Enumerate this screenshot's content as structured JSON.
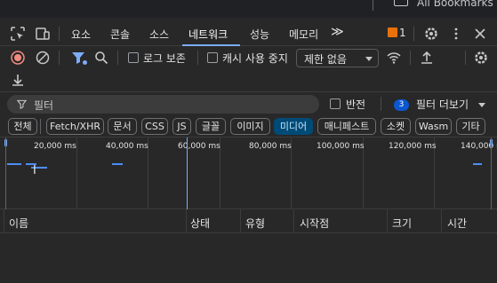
{
  "bookmarks_bar": {
    "label": "All Bookmarks"
  },
  "tabs": [
    {
      "label": "요소"
    },
    {
      "label": "콘솔"
    },
    {
      "label": "소스"
    },
    {
      "label": "네트워크",
      "active": true
    },
    {
      "label": "성능"
    },
    {
      "label": "메모리"
    }
  ],
  "more_tabs": "≫",
  "issues_count": "1",
  "toolbar": {
    "preserve_log_label": "로그 보존",
    "disable_cache_label": "캐시 사용 중지",
    "throttling_value": "제한 없음"
  },
  "filter": {
    "placeholder": "필터",
    "invert_label": "반전",
    "more_filters_count": "3",
    "more_filters_label": "필터 더보기"
  },
  "type_filters": [
    "전체",
    "Fetch/XHR",
    "문서",
    "CSS",
    "JS",
    "글꼴",
    "이미지",
    "미디어",
    "매니페스트",
    "소켓",
    "Wasm",
    "기타"
  ],
  "active_type_filter": "미디어",
  "overview": {
    "ticks": [
      "20,000 ms",
      "40,000 ms",
      "60,000 ms",
      "80,000 ms",
      "100,000 ms",
      "120,000 ms",
      "140,000 ms"
    ]
  },
  "table": {
    "columns": [
      "이름",
      "상태",
      "유형",
      "시작점",
      "크기",
      "시간"
    ],
    "rows": []
  },
  "colors": {
    "panel_bg": "#282828",
    "accent": "#7cacf8",
    "active_chip_bg": "#004a77",
    "record_red": "#f28b82",
    "issue_flag": "#e8710a",
    "badge_blue": "#0b57d0"
  }
}
